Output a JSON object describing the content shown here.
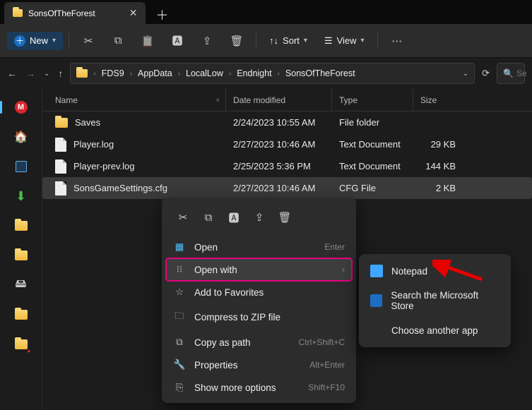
{
  "tab": {
    "title": "SonsOfTheForest"
  },
  "toolbar": {
    "new_label": "New",
    "sort_label": "Sort",
    "view_label": "View"
  },
  "breadcrumb": [
    "FDS9",
    "AppData",
    "LocalLow",
    "Endnight",
    "SonsOfTheForest"
  ],
  "search": {
    "placeholder": "Se"
  },
  "columns": {
    "name": "Name",
    "date": "Date modified",
    "type": "Type",
    "size": "Size"
  },
  "rows": [
    {
      "name": "Saves",
      "date": "2/24/2023 10:55 AM",
      "type": "File folder",
      "size": "",
      "kind": "folder"
    },
    {
      "name": "Player.log",
      "date": "2/27/2023 10:46 AM",
      "type": "Text Document",
      "size": "29 KB",
      "kind": "file"
    },
    {
      "name": "Player-prev.log",
      "date": "2/25/2023 5:36 PM",
      "type": "Text Document",
      "size": "144 KB",
      "kind": "file"
    },
    {
      "name": "SonsGameSettings.cfg",
      "date": "2/27/2023 10:46 AM",
      "type": "CFG File",
      "size": "2 KB",
      "kind": "file",
      "selected": true
    }
  ],
  "context_menu": {
    "open": "Open",
    "open_shortcut": "Enter",
    "open_with": "Open with",
    "add_fav": "Add to Favorites",
    "compress": "Compress to ZIP file",
    "copy_path": "Copy as path",
    "copy_path_shortcut": "Ctrl+Shift+C",
    "properties": "Properties",
    "properties_shortcut": "Alt+Enter",
    "show_more": "Show more options",
    "show_more_shortcut": "Shift+F10"
  },
  "submenu": {
    "notepad": "Notepad",
    "store": "Search the Microsoft Store",
    "choose": "Choose another app"
  }
}
